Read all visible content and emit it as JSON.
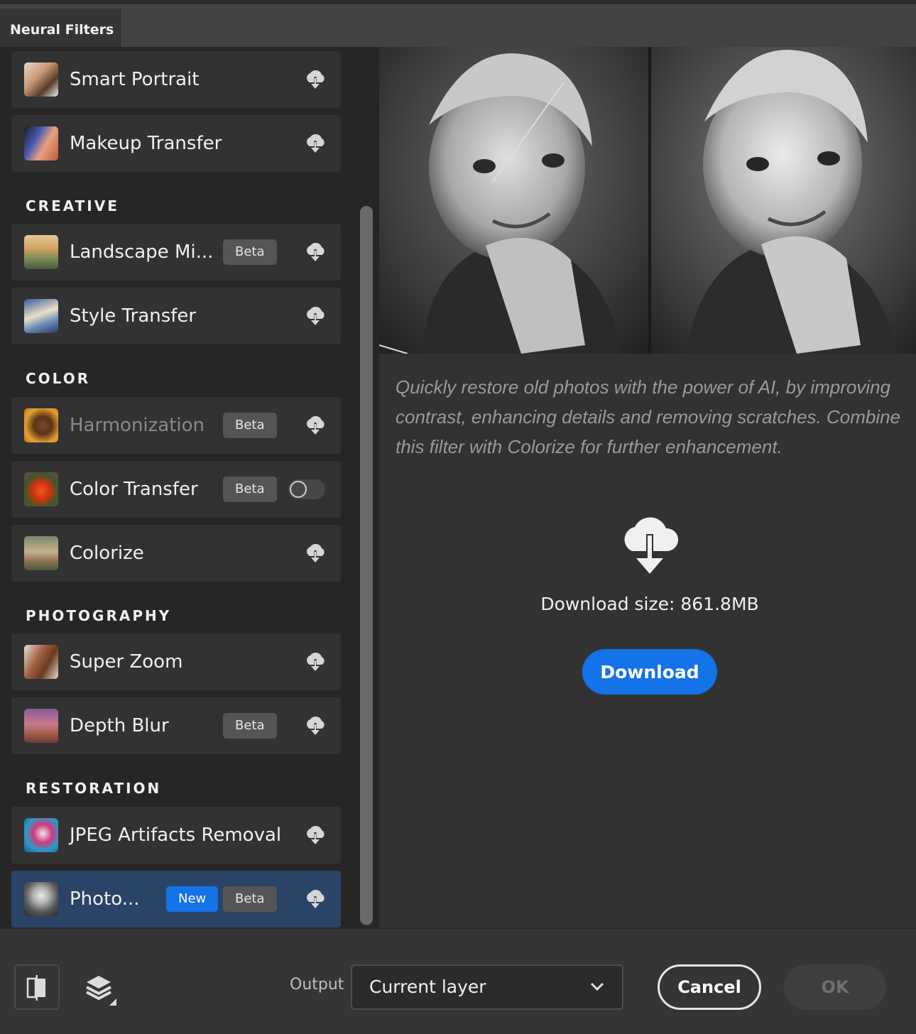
{
  "window": {
    "tab_title": "Neural Filters"
  },
  "sections": {
    "creative": "CREATIVE",
    "color": "COLOR",
    "photography": "PHOTOGRAPHY",
    "restoration": "RESTORATION"
  },
  "filters": [
    {
      "label": "Smart Portrait",
      "icon": "cloud-download-icon"
    },
    {
      "label": "Makeup Transfer",
      "icon": "cloud-download-icon"
    },
    {
      "label": "Landscape Mi...",
      "badge": "Beta",
      "icon": "cloud-download-icon"
    },
    {
      "label": "Style Transfer",
      "icon": "cloud-download-icon"
    },
    {
      "label": "Harmonization",
      "badge": "Beta",
      "icon": "cloud-download-icon",
      "disabled": true
    },
    {
      "label": "Color Transfer",
      "badge": "Beta",
      "control": "toggle",
      "toggle_on": false
    },
    {
      "label": "Colorize",
      "icon": "cloud-download-icon"
    },
    {
      "label": "Super Zoom",
      "icon": "cloud-download-icon"
    },
    {
      "label": "Depth Blur",
      "badge": "Beta",
      "icon": "cloud-download-icon"
    },
    {
      "label": "JPEG Artifacts Removal",
      "icon": "cloud-download-icon"
    },
    {
      "label": "Photo...",
      "badge_new": "New",
      "badge": "Beta",
      "icon": "cloud-download-icon",
      "selected": true
    }
  ],
  "detail": {
    "description": "Quickly restore old photos with the power of AI, by improving contrast, enhancing details and removing scratches. Combine this filter with Colorize for further enhancement.",
    "download_size": "Download size: 861.8MB",
    "download_label": "Download"
  },
  "footer": {
    "output_label": "Output",
    "output_value": "Current layer",
    "cancel_label": "Cancel",
    "ok_label": "OK"
  },
  "colors": {
    "accent": "#1473e6",
    "selected_row": "#2a4468",
    "panel_bg": "#262626",
    "row_bg": "#323232"
  }
}
